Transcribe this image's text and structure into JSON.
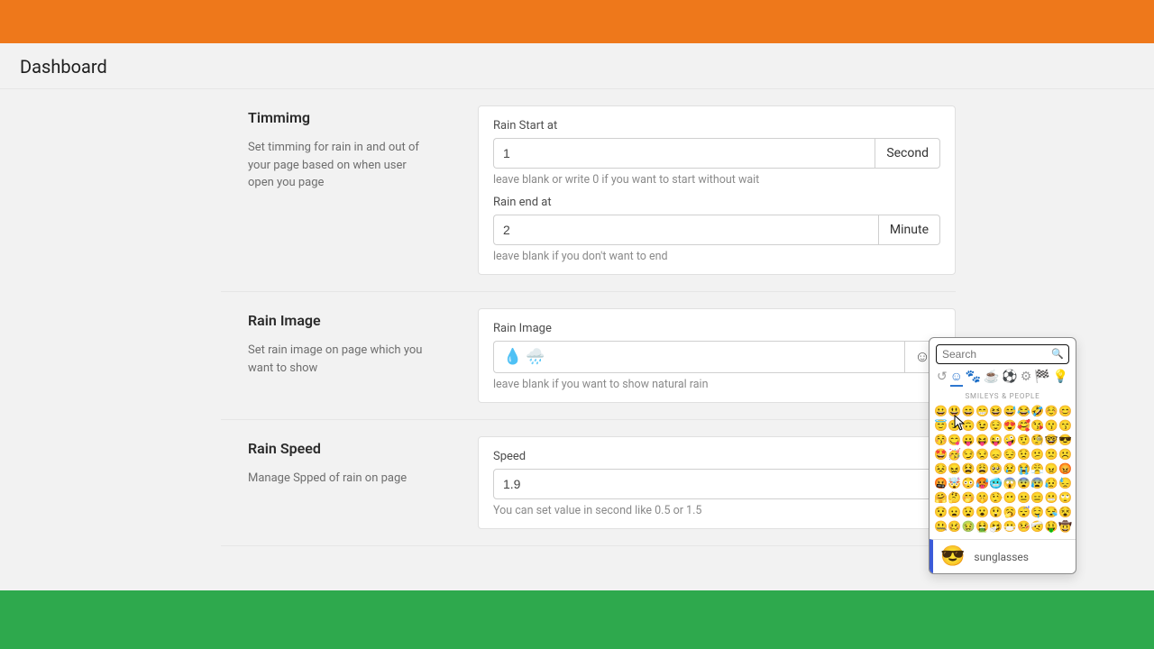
{
  "page_title": "Dashboard",
  "sections": {
    "timing": {
      "title": "Timmimg",
      "desc": "Set timming for rain in and out of your page based on when user open you page",
      "start_label": "Rain Start at",
      "start_value": "1",
      "start_unit": "Second",
      "start_help": "leave blank or write 0 if you want to start without wait",
      "end_label": "Rain end at",
      "end_value": "2",
      "end_unit": "Minute",
      "end_help": "leave blank if you don't want to end"
    },
    "image": {
      "title": "Rain Image",
      "desc": "Set rain image on page which you want to show",
      "label": "Rain Image",
      "value_emoji_1": "💧",
      "value_emoji_2": "🌧️",
      "help": "leave blank if you want to show natural rain"
    },
    "speed": {
      "title": "Rain Speed",
      "desc": "Manage Spped of rain on page",
      "label": "Speed",
      "value": "1.9",
      "help": "You can set value in second like 0.5 or 1.5"
    }
  },
  "picker": {
    "search_placeholder": "Search",
    "category_header": "SMILEYS & PEOPLE",
    "selected_emoji": "😎",
    "selected_name": "sunglasses",
    "cat_icons": [
      "↺",
      "☺",
      "🐾",
      "☕",
      "⚽",
      "⚙",
      "🏁",
      "💡"
    ],
    "rows": [
      [
        "😀",
        "😃",
        "😄",
        "😁",
        "😆",
        "😅",
        "😂",
        "🤣",
        "☺️",
        "😊"
      ],
      [
        "😇",
        "🙂",
        "🙃",
        "😉",
        "😌",
        "😍",
        "🥰",
        "😘",
        "😗",
        "😙"
      ],
      [
        "😚",
        "😋",
        "😛",
        "😝",
        "😜",
        "🤪",
        "🤨",
        "🧐",
        "🤓",
        "😎"
      ],
      [
        "🤩",
        "🥳",
        "😏",
        "😒",
        "😞",
        "😔",
        "😟",
        "😕",
        "🙁",
        "☹️"
      ],
      [
        "😣",
        "😖",
        "😫",
        "😩",
        "🥺",
        "😢",
        "😭",
        "😤",
        "😠",
        "😡"
      ],
      [
        "🤬",
        "🤯",
        "😳",
        "🥵",
        "🥶",
        "😱",
        "😨",
        "😰",
        "😥",
        "😓"
      ],
      [
        "🤗",
        "🤔",
        "🤭",
        "🤫",
        "🤥",
        "😶",
        "😐",
        "😑",
        "😬",
        "🙄"
      ],
      [
        "😯",
        "😦",
        "😧",
        "😮",
        "😲",
        "🥱",
        "😴",
        "🤤",
        "😪",
        "😵"
      ],
      [
        "🤐",
        "🥴",
        "🤢",
        "🤮",
        "🤧",
        "😷",
        "🤒",
        "🤕",
        "🤑",
        "🤠"
      ]
    ]
  }
}
